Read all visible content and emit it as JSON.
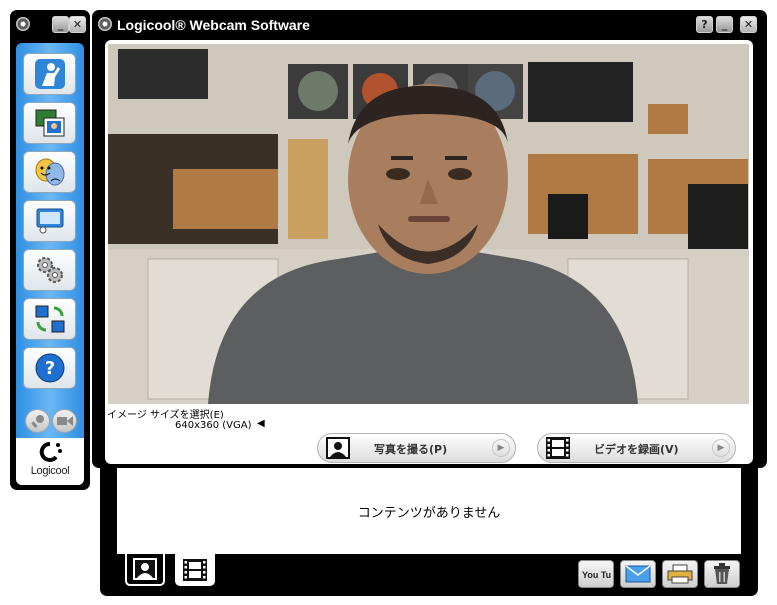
{
  "sidebar": {
    "tools": [
      {
        "icon": "webcam-person-icon"
      },
      {
        "icon": "photo-gallery-icon"
      },
      {
        "icon": "video-effects-masks-icon"
      },
      {
        "icon": "display-screen-icon"
      },
      {
        "icon": "settings-gears-icon"
      },
      {
        "icon": "share-transfer-icon"
      },
      {
        "icon": "help-icon"
      }
    ],
    "brand": "Logicool"
  },
  "window": {
    "title": "Logicool® Webcam Software"
  },
  "capture": {
    "image_size_label": "イメージ サイズを選択(E)",
    "image_size_value": "640x360 (VGA)",
    "take_photo_label": "写真を撮る(P)",
    "record_video_label": "ビデオを録画(V)"
  },
  "gallery": {
    "empty_text": "コンテンツがありません",
    "tabs": [
      {
        "icon": "photo-tab-icon",
        "selected": true
      },
      {
        "icon": "video-tab-icon",
        "selected": false
      }
    ],
    "actions": [
      {
        "icon": "youtube-icon",
        "text": "You Tube"
      },
      {
        "icon": "email-icon"
      },
      {
        "icon": "print-icon"
      },
      {
        "icon": "trash-icon"
      }
    ]
  },
  "colors": {
    "sidebar_blue": "#2f8fe2",
    "youtube_red": "#e02020"
  }
}
